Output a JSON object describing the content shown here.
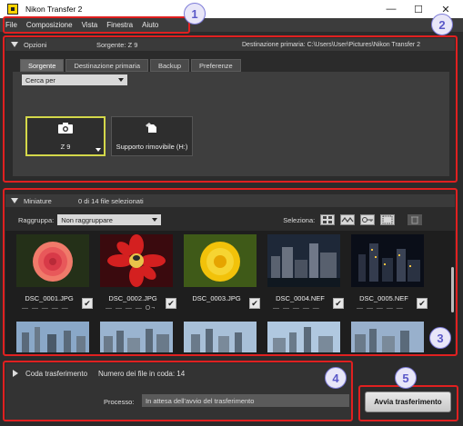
{
  "window": {
    "title": "Nikon Transfer 2",
    "controls": [
      "—",
      "☐",
      "✕"
    ]
  },
  "menu": [
    "File",
    "Composizione",
    "Vista",
    "Finestra",
    "Aiuto"
  ],
  "options_panel": {
    "title": "Opzioni",
    "source_label": "Sorgente: Z 9",
    "destination_label": "Destinazione primaria: C:\\Users\\User\\Pictures\\Nikon Transfer 2",
    "tabs": [
      "Sorgente",
      "Destinazione primaria",
      "Backup",
      "Preferenze"
    ],
    "active_tab": "Sorgente",
    "search_by": "Cerca per",
    "devices": [
      {
        "label": "Z 9",
        "icon": "camera-icon",
        "selected": true
      },
      {
        "label": "Supporto rimovibile (H:)",
        "icon": "removable-media-icon",
        "selected": false
      }
    ]
  },
  "thumbnails_panel": {
    "title": "Miniature",
    "selection_count": "0 di 14 file selezionati",
    "group_label": "Raggruppa:",
    "group_value": "Non raggruppare",
    "select_label": "Seleziona:",
    "files": [
      {
        "name": "DSC_0001.JPG",
        "rating": "— — — — —",
        "checked": true
      },
      {
        "name": "DSC_0002.JPG",
        "rating": "— — — — O¬",
        "checked": true
      },
      {
        "name": "DSC_0003.JPG",
        "rating": "",
        "checked": true
      },
      {
        "name": "DSC_0004.NEF",
        "rating": "— — — — —",
        "checked": true
      },
      {
        "name": "DSC_0005.NEF",
        "rating": "— — — — —",
        "checked": true
      }
    ]
  },
  "queue_panel": {
    "title": "Coda trasferimento",
    "queue_count": "Numero dei file in coda: 14",
    "process_label": "Processo:",
    "process_status": "In attesa dell'avvio del trasferimento"
  },
  "start_button": "Avvia trasferimento",
  "callouts": [
    "1",
    "2",
    "3",
    "4",
    "5"
  ],
  "colors": {
    "callout_border": "#e02020",
    "callout_fill": "#e8e6f8",
    "callout_text": "#5a58c8",
    "selected_device": "#d4d84a"
  }
}
